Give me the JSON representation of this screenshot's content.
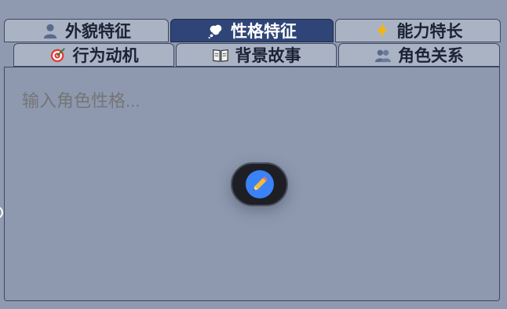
{
  "tabs_row1": [
    {
      "label": "外貌特征",
      "icon": "person-silhouette-icon",
      "active": false
    },
    {
      "label": "性格特征",
      "icon": "thought-bubble-icon",
      "active": true
    },
    {
      "label": "能力特长",
      "icon": "lightning-icon",
      "active": false
    }
  ],
  "tabs_row2": [
    {
      "label": "行为动机",
      "icon": "target-icon",
      "active": false
    },
    {
      "label": "背景故事",
      "icon": "open-book-icon",
      "active": false
    },
    {
      "label": "角色关系",
      "icon": "people-icon",
      "active": false
    }
  ],
  "editor": {
    "placeholder": "输入角色性格..."
  },
  "fab": {
    "icon": "pencil-icon",
    "accent": "#3b82f6"
  }
}
